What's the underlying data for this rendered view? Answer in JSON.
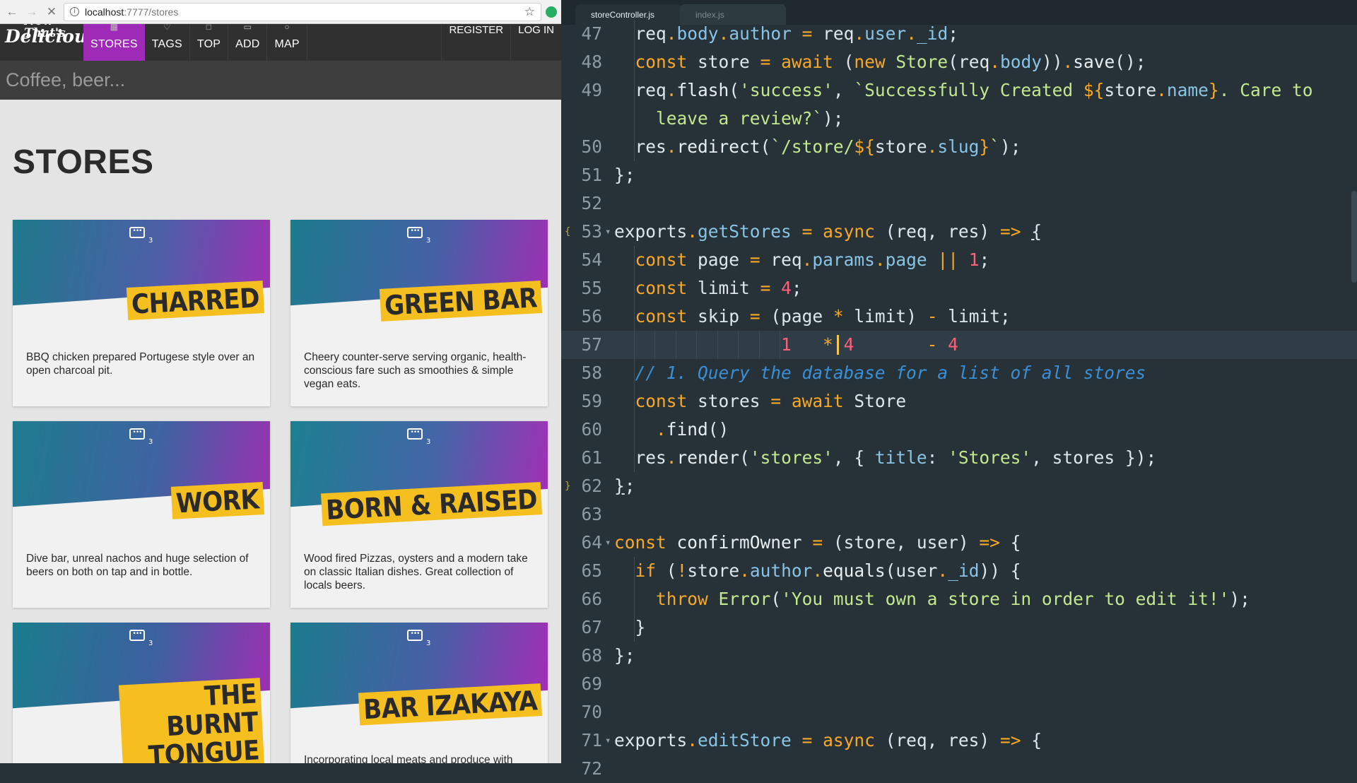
{
  "browser": {
    "url_host": "localhost",
    "url_path": ":7777/stores",
    "nav": {
      "logo_top": "Now That's",
      "logo": "Delicious!",
      "items": [
        {
          "label": "STORES",
          "icon": "store-icon"
        },
        {
          "label": "TAGS",
          "icon": "tag-icon"
        },
        {
          "label": "TOP",
          "icon": "trophy-icon"
        },
        {
          "label": "ADD",
          "icon": "add-icon"
        },
        {
          "label": "MAP",
          "icon": "map-icon"
        }
      ],
      "register": "REGISTER",
      "login": "LOG IN"
    },
    "search_placeholder": "Coffee, beer...",
    "heading": "STORES",
    "stores": [
      {
        "name": "CHARRED",
        "comments": "3",
        "description": "BBQ chicken prepared Portugese style over an open charcoal pit.",
        "colors": [
          "#1f7a8c",
          "#4d5fa8",
          "#a22fb5"
        ]
      },
      {
        "name": "GREEN BAR",
        "comments": "3",
        "description": "Cheery counter-serve serving organic, health-conscious fare such as smoothies & simple vegan eats.",
        "colors": [
          "#1d7b8e",
          "#4661a6",
          "#a12db3"
        ]
      },
      {
        "name": "WORK",
        "comments": "3",
        "description": "Dive bar, unreal nachos and huge selection of beers on both on tap and in bottle.",
        "colors": [
          "#1e7c8f",
          "#3f63a2",
          "#9d2fb2"
        ]
      },
      {
        "name": "BORN & RAISED",
        "comments": "3",
        "description": "Wood fired Pizzas, oysters and a modern take on classic Italian dishes. Great collection of locals beers.",
        "colors": [
          "#1c7f91",
          "#4565a7",
          "#a52eb6"
        ]
      },
      {
        "name": "THE BURNT TONGUE",
        "comments": "3",
        "description": "",
        "colors": [
          "#1a7d8d",
          "#3e5fa0",
          "#a22db4"
        ]
      },
      {
        "name": "BAR IZAKAYA",
        "comments": "3",
        "description": "Incorporating local meats and produce with",
        "colors": [
          "#1b7c8e",
          "#4a5ea6",
          "#a72db8"
        ]
      }
    ]
  },
  "editor": {
    "tabs": [
      "storeController.js",
      "index.js"
    ],
    "lines": [
      {
        "n": "47",
        "html": "  <span class=\"w\">req</span><span class=\"o\">.</span><span class=\"p\">body</span><span class=\"o\">.</span><span class=\"p\">author</span> <span class=\"o\">=</span> <span class=\"w\">req</span><span class=\"o\">.</span><span class=\"p\">user</span><span class=\"o\">.</span><span class=\"p\">_id</span>;"
      },
      {
        "n": "48",
        "html": "  <span class=\"k\">const</span> <span class=\"w\">store</span> <span class=\"o\">=</span> <span class=\"k\">await</span> (<span class=\"k\">new</span> <span class=\"cl\">Store</span>(<span class=\"w\">req</span><span class=\"o\">.</span><span class=\"p\">body</span>))<span class=\"o\">.</span><span class=\"f\">save</span>();"
      },
      {
        "n": "49",
        "html": "  <span class=\"w\">req</span><span class=\"o\">.</span><span class=\"f\">flash</span>(<span class=\"s\">'success'</span>, <span class=\"s\">`Successfully Created </span><span class=\"o\">${</span><span class=\"w\">store</span><span class=\"o\">.</span><span class=\"p\">name</span><span class=\"o\">}</span><span class=\"s\">. Care to</span>"
      },
      {
        "n": "",
        "html": "    <span class=\"s\">leave a review?`</span>);"
      },
      {
        "n": "50",
        "html": "  <span class=\"w\">res</span><span class=\"o\">.</span><span class=\"f\">redirect</span>(<span class=\"s\">`/store/</span><span class=\"o\">${</span><span class=\"w\">store</span><span class=\"o\">.</span><span class=\"p\">slug</span><span class=\"o\">}</span><span class=\"s\">`</span>);"
      },
      {
        "n": "51",
        "html": "};"
      },
      {
        "n": "52",
        "html": ""
      },
      {
        "n": "53",
        "fold": true,
        "mark": "{",
        "html": "<span class=\"w\">exports</span><span class=\"o\">.</span><span class=\"p\">getStores</span> <span class=\"o\">=</span> <span class=\"k\">async</span> (<span class=\"w\">req</span>, <span class=\"w\">res</span>) <span class=\"o\">=&gt;</span> <span style=\"text-decoration:underline\">{</span>"
      },
      {
        "n": "54",
        "html": "  <span class=\"k\">const</span> <span class=\"w\">page</span> <span class=\"o\">=</span> <span class=\"w\">req</span><span class=\"o\">.</span><span class=\"p\">params</span><span class=\"o\">.</span><span class=\"p\">page</span> <span class=\"o\">||</span> <span class=\"n\">1</span>;"
      },
      {
        "n": "55",
        "html": "  <span class=\"k\">const</span> <span class=\"w\">limit</span> <span class=\"o\">=</span> <span class=\"n\">4</span>;"
      },
      {
        "n": "56",
        "html": "  <span class=\"k\">const</span> <span class=\"w\">skip</span> <span class=\"o\">=</span> (<span class=\"w\">page</span> <span class=\"o\">*</span> <span class=\"w\">limit</span>) <span class=\"o\">-</span> <span class=\"w\">limit</span>;"
      },
      {
        "n": "57",
        "current": true,
        "html": "                <span class=\"n\">1</span>   <span class=\"o\">*</span> <span class=\"n\">4</span>       <span class=\"o\">-</span> <span class=\"n\">4</span>"
      },
      {
        "n": "58",
        "html": "  <span class=\"c\">// 1. Query the database for a list of all stores</span>"
      },
      {
        "n": "59",
        "html": "  <span class=\"k\">const</span> <span class=\"w\">stores</span> <span class=\"o\">=</span> <span class=\"k\">await</span> <span class=\"w\">Store</span>"
      },
      {
        "n": "60",
        "html": "    <span class=\"o\">.</span><span class=\"f\">find</span>()"
      },
      {
        "n": "61",
        "html": "  <span class=\"w\">res</span><span class=\"o\">.</span><span class=\"f\">render</span>(<span class=\"s\">'stores'</span>, { <span class=\"p\">title</span>: <span class=\"s\">'Stores'</span>, <span class=\"w\">stores</span> });"
      },
      {
        "n": "62",
        "mark": "}",
        "html": "<span style=\"text-decoration:underline\">}</span>;"
      },
      {
        "n": "63",
        "html": ""
      },
      {
        "n": "64",
        "fold": true,
        "html": "<span class=\"k\">const</span> <span class=\"f\">confirmOwner</span> <span class=\"o\">=</span> (<span class=\"w\">store</span>, <span class=\"w\">user</span>) <span class=\"o\">=&gt;</span> {"
      },
      {
        "n": "65",
        "html": "  <span class=\"k\">if</span> (<span class=\"o\">!</span><span class=\"w\">store</span><span class=\"o\">.</span><span class=\"p\">author</span><span class=\"o\">.</span><span class=\"f\">equals</span>(<span class=\"w\">user</span><span class=\"o\">.</span><span class=\"p\">_id</span>)) {"
      },
      {
        "n": "66",
        "html": "    <span class=\"k\">throw</span> <span class=\"cl\">Error</span>(<span class=\"s\">'You must own a store in order to edit it!'</span>);"
      },
      {
        "n": "67",
        "html": "  }"
      },
      {
        "n": "68",
        "html": "};"
      },
      {
        "n": "69",
        "html": ""
      },
      {
        "n": "70",
        "html": ""
      },
      {
        "n": "71",
        "fold": true,
        "html": "<span class=\"w\">exports</span><span class=\"o\">.</span><span class=\"p\">editStore</span> <span class=\"o\">=</span> <span class=\"k\">async</span> (<span class=\"w\">req</span>, <span class=\"w\">res</span>) <span class=\"o\">=&gt;</span> {"
      },
      {
        "n": "72",
        "html": ""
      }
    ]
  }
}
